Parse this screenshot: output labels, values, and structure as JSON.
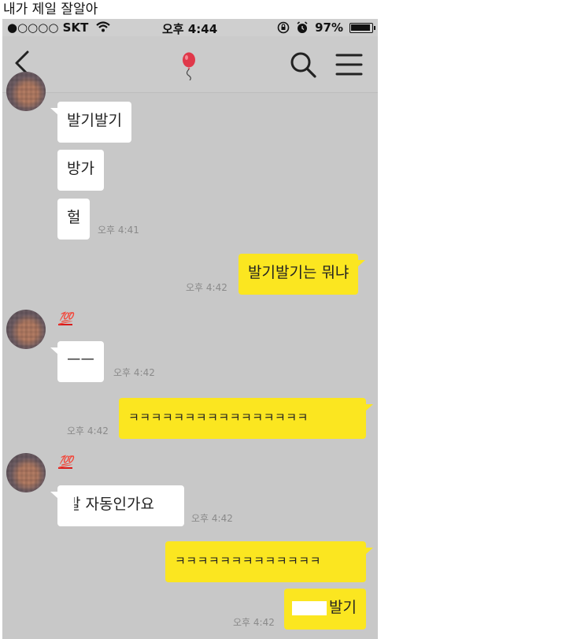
{
  "post": {
    "title": "내가 제일 잘알아"
  },
  "statusbar": {
    "carrier": "●○○○○ SKT",
    "time": "오후 4:44",
    "battery": "97%",
    "icons": [
      "wifi-icon",
      "rotation-lock-icon",
      "alarm-icon",
      "battery-icon"
    ]
  },
  "navbar": {
    "icons": [
      "back-icon",
      "balloon-icon",
      "search-icon",
      "menu-icon"
    ]
  },
  "colors": {
    "background": "#c8c8c8",
    "my_bubble": "#fbe620",
    "their_bubble": "#ffffff",
    "sender_name": "#d81b1b"
  },
  "messages": [
    {
      "side": "left",
      "text": "발기발기"
    },
    {
      "side": "left",
      "text": "방가"
    },
    {
      "side": "left",
      "text": "헐",
      "time": "오후 4:41"
    },
    {
      "side": "right",
      "text": "발기발기는 뭐냐",
      "time": "오후 4:42"
    },
    {
      "side": "left",
      "sender": "💯",
      "text": "ㅡㅡ",
      "time": "오후 4:42"
    },
    {
      "side": "right",
      "text": "ㅋㅋㅋㅋㅋㅋㅋㅋㅋㅋㅋㅋㅋㅋㅋㅋ",
      "time": "오후 4:42"
    },
    {
      "side": "left",
      "sender": "💯",
      "text": "발 자동인가요",
      "time": "오후 4:42"
    },
    {
      "side": "right",
      "text": "ㅋㅋㅋㅋㅋㅋㅋㅋㅋㅋㅋㅋㅋ"
    },
    {
      "side": "right",
      "text": "발기",
      "time": "오후 4:42"
    }
  ]
}
